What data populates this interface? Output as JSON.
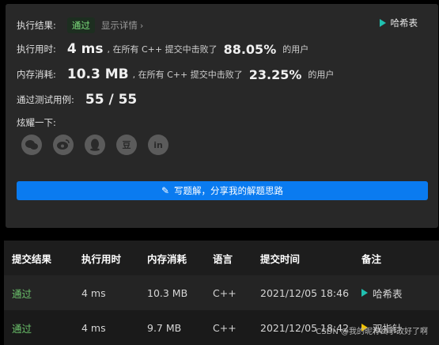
{
  "result": {
    "label": "执行结果:",
    "status": "通过",
    "detail_link": "显示详情",
    "tag": "哈希表"
  },
  "runtime": {
    "label": "执行用时:",
    "value": "4 ms",
    "mid_text": ", 在所有 C++ 提交中击败了",
    "percent": "88.05%",
    "suffix": "的用户"
  },
  "memory": {
    "label": "内存消耗:",
    "value": "10.3 MB",
    "mid_text": ", 在所有 C++ 提交中击败了",
    "percent": "23.25%",
    "suffix": "的用户"
  },
  "tests": {
    "label": "通过测试用例:",
    "value": "55 / 55"
  },
  "share": {
    "label": "炫耀一下:",
    "icons": [
      "wechat-icon",
      "weibo-icon",
      "qq-icon",
      "douban-icon",
      "linkedin-icon"
    ],
    "douban_glyph": "豆",
    "linkedin_glyph": "in"
  },
  "solution_button": "写题解，分享我的解题思路",
  "table": {
    "headers": [
      "提交结果",
      "执行用时",
      "内存消耗",
      "语言",
      "提交时间",
      "备注"
    ],
    "rows": [
      {
        "status": "通过",
        "runtime": "4 ms",
        "memory": "10.3 MB",
        "lang": "C++",
        "time": "2021/12/05 18:46",
        "note": "哈希表",
        "flag_color": "#20c0b0"
      },
      {
        "status": "通过",
        "runtime": "4 ms",
        "memory": "9.7 MB",
        "lang": "C++",
        "time": "2021/12/05 18:42",
        "note": "双指针",
        "flag_color": "#f2c200"
      }
    ]
  },
  "watermark": "CSDN @我的昵称终于改好了啊",
  "colors": {
    "accent": "#0a7bf0",
    "pass": "#6cc36c",
    "teal_flag": "#20c0b0",
    "yellow_flag": "#f2c200"
  }
}
